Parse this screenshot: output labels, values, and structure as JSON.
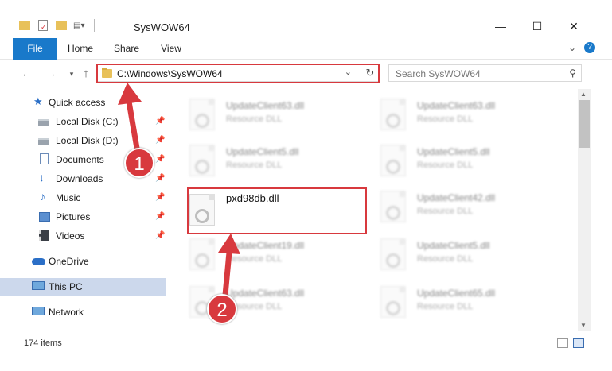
{
  "window": {
    "title": "SysWOW64",
    "controls": [
      "—",
      "☐",
      "✕"
    ]
  },
  "ribbon": {
    "tabs": [
      "File",
      "Home",
      "Share",
      "View"
    ],
    "expand": "⌄",
    "help": "?"
  },
  "address": {
    "path": "C:\\Windows\\SysWOW64",
    "search_placeholder": "Search SysWOW64"
  },
  "sidebar": {
    "items": [
      {
        "label": "Quick access",
        "icon": "star-icon"
      },
      {
        "label": "Local Disk (C:)",
        "icon": "drive-icon",
        "pinned": true
      },
      {
        "label": "Local Disk (D:)",
        "icon": "drive-icon",
        "pinned": true
      },
      {
        "label": "Documents",
        "icon": "documents-icon",
        "pinned": true
      },
      {
        "label": "Downloads",
        "icon": "downloads-icon",
        "pinned": true
      },
      {
        "label": "Music",
        "icon": "music-icon",
        "pinned": true
      },
      {
        "label": "Pictures",
        "icon": "pictures-icon",
        "pinned": true
      },
      {
        "label": "Videos",
        "icon": "videos-icon",
        "pinned": true
      },
      {
        "label": "OneDrive",
        "icon": "cloud-icon"
      },
      {
        "label": "This PC",
        "icon": "computer-icon",
        "selected": true
      },
      {
        "label": "Network",
        "icon": "network-icon"
      }
    ]
  },
  "files": [
    {
      "name": "UpdateClient63.dll",
      "type": "Resource DLL"
    },
    {
      "name": "UpdateClient63.dll",
      "type": "Resource DLL"
    },
    {
      "name": "UpdateClient5.dll",
      "type": "Resource DLL"
    },
    {
      "name": "UpdateClient5.dll",
      "type": "Resource DLL"
    },
    {
      "name": "pxd98db.dll",
      "type": ""
    },
    {
      "name": "UpdateClient42.dll",
      "type": "Resource DLL"
    },
    {
      "name": "UpdateClient19.dll",
      "type": "Resource DLL"
    },
    {
      "name": "UpdateClient5.dll",
      "type": "Resource DLL"
    },
    {
      "name": "UpdateClient63.dll",
      "type": "Resource DLL"
    },
    {
      "name": "UpdateClient65.dll",
      "type": "Resource DLL"
    }
  ],
  "status": {
    "item_count": "174 items"
  },
  "annotations": {
    "step1": "1",
    "step2": "2"
  },
  "colors": {
    "accent": "#1979ca",
    "highlight": "#d8393e",
    "selection": "#ccd8ec"
  }
}
